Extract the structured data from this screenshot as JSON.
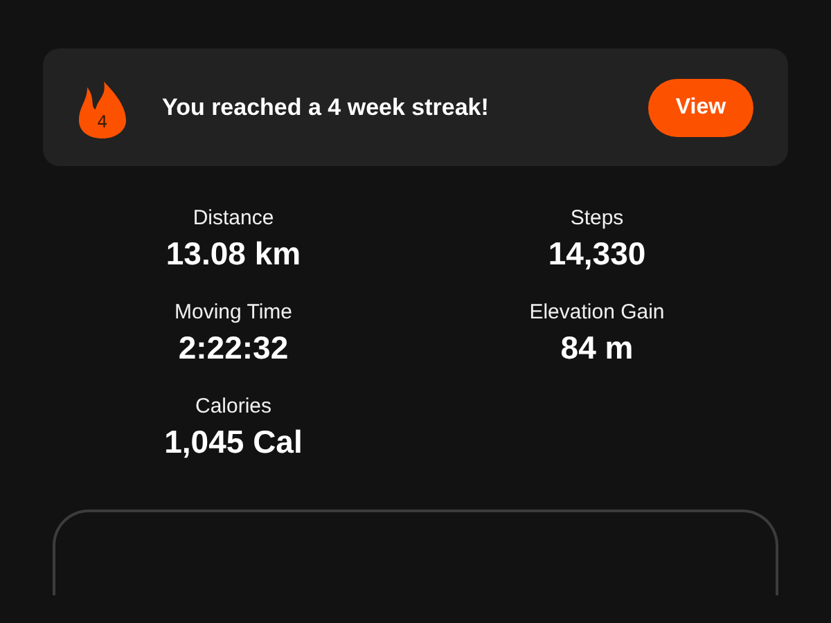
{
  "streak_banner": {
    "streak_count": "4",
    "message": "You reached a 4 week streak!",
    "button": "View"
  },
  "stats": [
    {
      "label": "Distance",
      "value": "13.08 km"
    },
    {
      "label": "Steps",
      "value": "14,330"
    },
    {
      "label": "Moving Time",
      "value": "2:22:32"
    },
    {
      "label": "Elevation Gain",
      "value": "84 m"
    },
    {
      "label": "Calories",
      "value": "1,045 Cal"
    }
  ]
}
